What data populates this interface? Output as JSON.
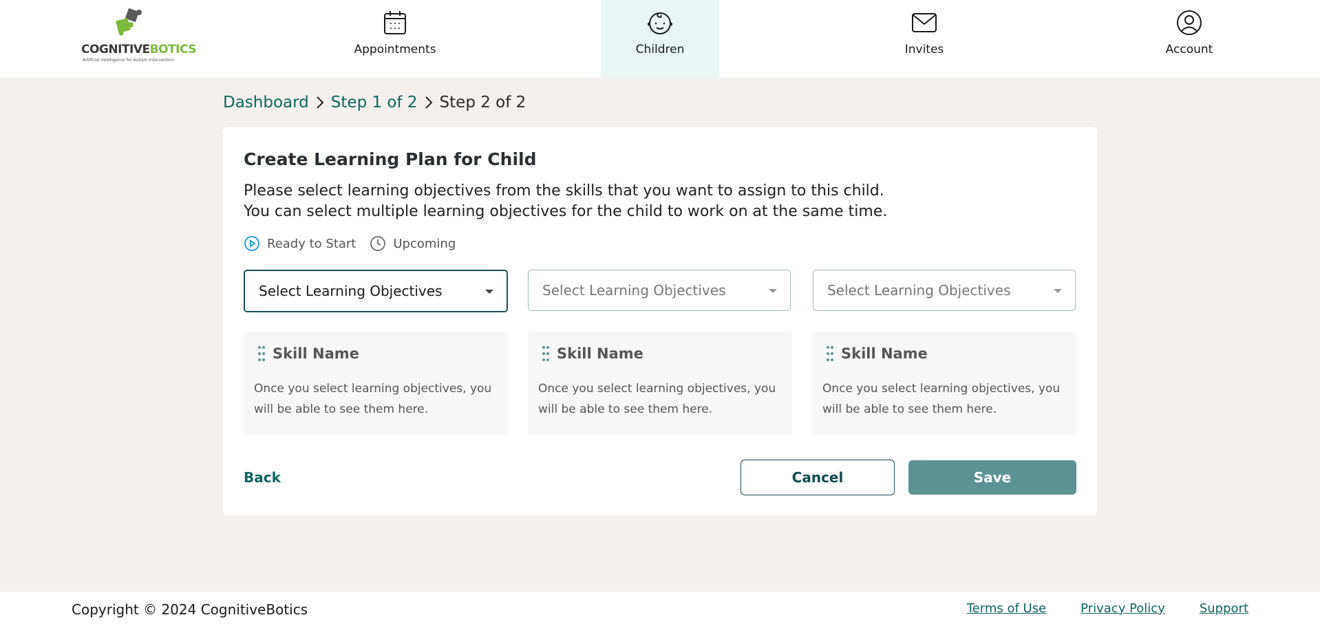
{
  "brand": {
    "name_part1": "COGNITIVE",
    "name_part2": "BOTICS",
    "tagline": "Artificial Intelligence for Autism Intervention"
  },
  "nav": {
    "items": [
      {
        "label": "Appointments",
        "icon": "calendar-icon"
      },
      {
        "label": "Children",
        "icon": "child-face-icon",
        "active": true
      },
      {
        "label": "Invites",
        "icon": "envelope-icon"
      },
      {
        "label": "Account",
        "icon": "user-circle-icon"
      }
    ]
  },
  "breadcrumb": {
    "items": [
      "Dashboard",
      "Step 1 of 2",
      "Step 2 of 2"
    ]
  },
  "page": {
    "title": "Create Learning Plan for Child",
    "description_line1": "Please select learning objectives from the skills that you want to assign to this child.",
    "description_line2": "You can select multiple learning objectives for the child to work on at the same time."
  },
  "legend": {
    "ready": "Ready to Start",
    "upcoming": "Upcoming"
  },
  "columns": [
    {
      "select_value": "Select Learning Objectives",
      "skill_name": "Skill Name",
      "empty_text": "Once you select learning objectives, you will be able to see them here."
    },
    {
      "select_value": "Select Learning Objectives",
      "skill_name": "Skill Name",
      "empty_text": "Once you select learning objectives, you will be able to see them here."
    },
    {
      "select_value": "Select Learning Objectives",
      "skill_name": "Skill Name",
      "empty_text": "Once you select learning objectives, you will be able to see them here."
    }
  ],
  "actions": {
    "back": "Back",
    "cancel": "Cancel",
    "save": "Save"
  },
  "footer": {
    "copyright": "Copyright © 2024 CognitiveBotics",
    "links": [
      "Terms of Use",
      "Privacy Policy",
      "Support"
    ]
  },
  "colors": {
    "accent": "#0f6560",
    "save_button": "#5d9294",
    "ready_icon": "#2a9bd8",
    "active_nav_bg": "#eaf6f5"
  }
}
